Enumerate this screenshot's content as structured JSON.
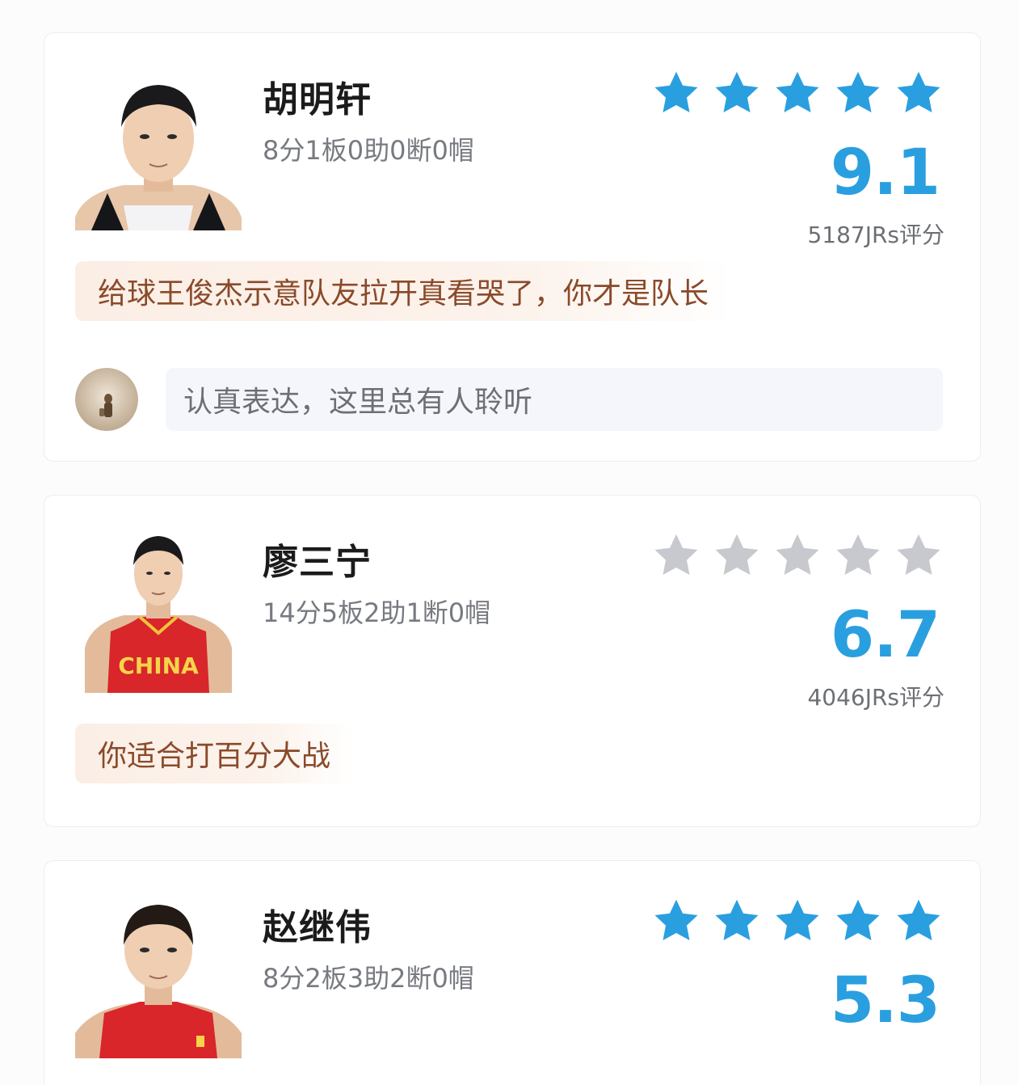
{
  "cards": [
    {
      "name": "胡明轩",
      "stats": "8分1板0助0断0帽",
      "stars_color": "#2a9fe0",
      "stars_filled": 5,
      "score": "9.1",
      "votes": "5187JRs评分",
      "comment": "给球王俊杰示意队友拉开真看哭了，你才是队长",
      "reply_placeholder": "认真表达，这里总有人聆听"
    },
    {
      "name": "廖三宁",
      "stats": "14分5板2助1断0帽",
      "stars_color": "#c7c9ce",
      "stars_filled": 0,
      "score": "6.7",
      "votes": "4046JRs评分",
      "comment": "你适合打百分大战"
    },
    {
      "name": "赵继伟",
      "stats": "8分2板3助2断0帽",
      "stars_color": "#2a9fe0",
      "stars_filled": 5,
      "score": "5.3"
    }
  ],
  "colors": {
    "accent": "#2a9fe0",
    "star_gray": "#c7c9ce",
    "comment_text": "#8a4a2a",
    "comment_bg": "#fbeee5"
  }
}
